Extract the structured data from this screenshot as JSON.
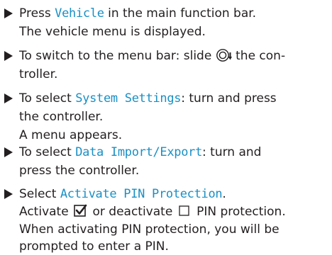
{
  "steps": [
    {
      "lines": [
        {
          "pre": "Press ",
          "ui": "Vehicle",
          "post": " in the main function bar."
        },
        {
          "pre": "The vehicle menu is displayed."
        }
      ]
    },
    {
      "lines": [
        {
          "pre": "To switch to the menu bar: slide ",
          "icon": "controller-slide-down-icon",
          "post": " the con-"
        },
        {
          "pre": "troller."
        }
      ]
    },
    {
      "lines": [
        {
          "pre": "To select ",
          "ui": "System Settings",
          "post": ": turn and press"
        },
        {
          "pre": "the controller."
        },
        {
          "pre": "A menu appears."
        }
      ]
    },
    {
      "lines": [
        {
          "pre": "To select ",
          "ui": "Data Import/Export",
          "post": ": turn and"
        },
        {
          "pre": "press the controller."
        }
      ]
    },
    {
      "lines": [
        {
          "pre": "Select ",
          "ui": "Activate PIN Protection",
          "post": "."
        },
        {
          "pre": "Activate ",
          "icon": "checkbox-checked-icon",
          "mid": " or deactivate ",
          "icon2": "checkbox-empty-icon",
          "post": " PIN protection."
        },
        {
          "pre": "When activating PIN protection, you will be"
        },
        {
          "pre": "prompted to enter a PIN."
        }
      ]
    }
  ],
  "colors": {
    "text": "#231f20",
    "ui_highlight": "#1a8fc4"
  }
}
